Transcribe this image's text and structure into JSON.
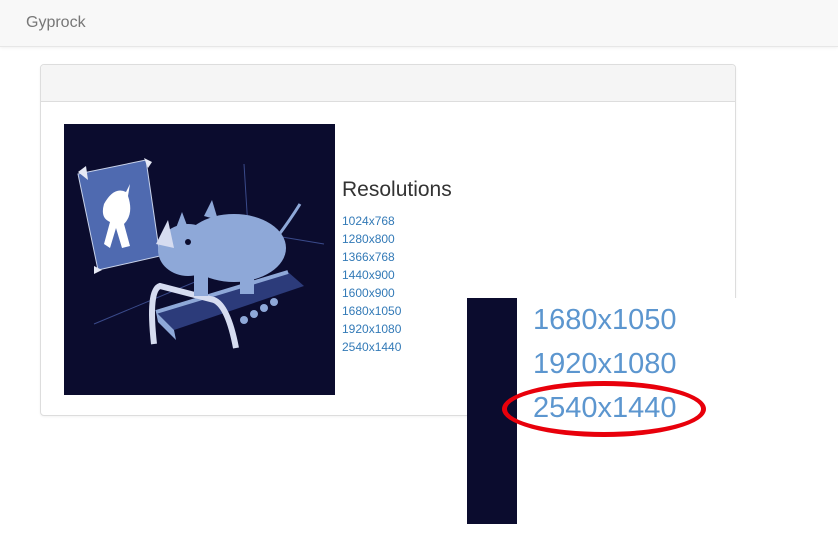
{
  "navbar": {
    "brand": "Gyprock"
  },
  "content": {
    "title": "Resolutions",
    "resolutions": [
      "1024x768",
      "1280x800",
      "1366x768",
      "1440x900",
      "1600x900",
      "1680x1050",
      "1920x1080",
      "2540x1440"
    ]
  },
  "zoom": {
    "resolutions": [
      "1680x1050",
      "1920x1080",
      "2540x1440"
    ],
    "highlighted": "2540x1440"
  },
  "colors": {
    "link": "#337ab7",
    "wallpaper_bg": "#0b0c2e",
    "highlight": "#e8000b"
  }
}
